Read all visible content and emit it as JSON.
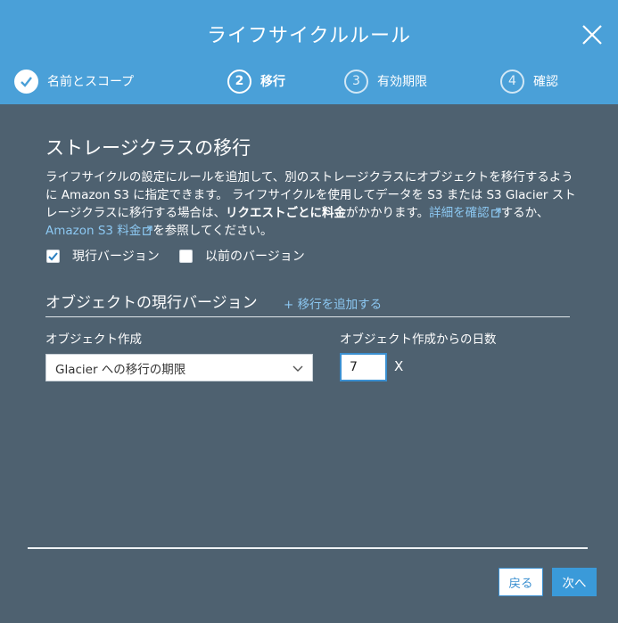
{
  "modal": {
    "title": "ライフサイクルルール",
    "steps": [
      {
        "number": "",
        "label": "名前とスコープ",
        "state": "done"
      },
      {
        "number": "2",
        "label": "移行",
        "state": "active"
      },
      {
        "number": "3",
        "label": "有効期限",
        "state": "pending"
      },
      {
        "number": "4",
        "label": "確認",
        "state": "pending"
      }
    ]
  },
  "content": {
    "section_title": "ストレージクラスの移行",
    "description": {
      "part1": "ライフサイクルの設定にルールを追加して、別のストレージクラスにオブジェクトを移行するように Amazon S3 に指定できます。 ライフサイクルを使用してデータを S3 または S3 Glacier ストレージクラスに移行する場合は、",
      "bold": "リクエストごとに料金",
      "part2": "がかかります。",
      "link1": "詳細を確認",
      "part3": "するか、",
      "link2": "Amazon S3 料金",
      "part4": "を参照してください。"
    },
    "checkboxes": [
      {
        "label": "現行バージョン",
        "checked": true
      },
      {
        "label": "以前のバージョン",
        "checked": false
      }
    ],
    "subsection_title": "オブジェクトの現行バージョン",
    "add_transition_label": "+ 移行を追加する",
    "columns": {
      "object_creation": "オブジェクト作成",
      "days_after_creation": "オブジェクト作成からの日数"
    },
    "transition_select_value": "Glacier への移行の期限",
    "days_value": "7",
    "remove_label": "X"
  },
  "footer": {
    "back_label": "戻る",
    "next_label": "次へ"
  },
  "colors": {
    "header": "#4aa0d8",
    "body": "#4e6170",
    "link": "#8cc8f2",
    "primary": "#3a9ad9"
  }
}
